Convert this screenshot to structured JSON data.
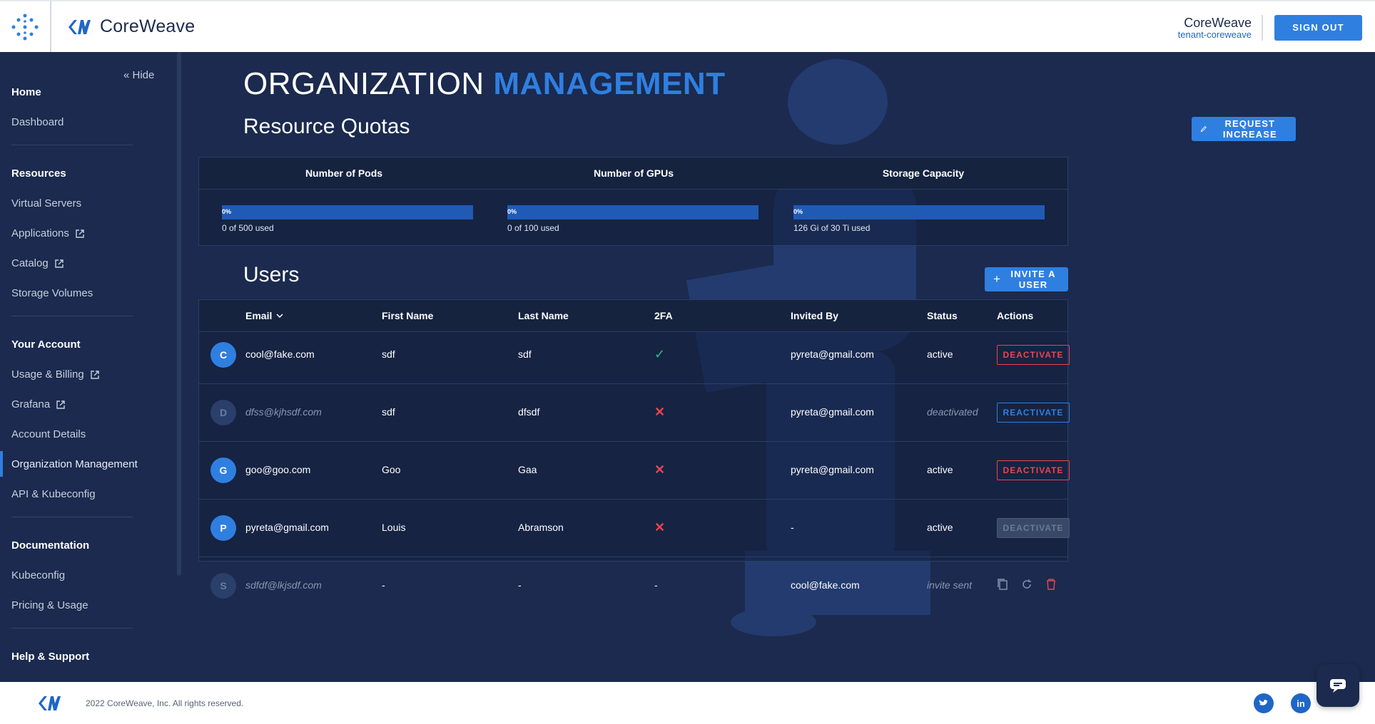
{
  "header": {
    "brand": "CoreWeave",
    "org_name": "CoreWeave",
    "tenant": "tenant-coreweave",
    "signout_label": "SIGN OUT"
  },
  "sidebar": {
    "hide_label": "Hide",
    "sections": [
      {
        "title": "Home",
        "items": [
          {
            "label": "Dashboard",
            "external": false
          }
        ]
      },
      {
        "title": "Resources",
        "items": [
          {
            "label": "Virtual Servers",
            "external": false
          },
          {
            "label": "Applications",
            "external": true
          },
          {
            "label": "Catalog",
            "external": true
          },
          {
            "label": "Storage Volumes",
            "external": false
          }
        ]
      },
      {
        "title": "Your Account",
        "items": [
          {
            "label": "Usage & Billing",
            "external": true
          },
          {
            "label": "Grafana",
            "external": true
          },
          {
            "label": "Account Details",
            "external": false
          },
          {
            "label": "Organization Management",
            "external": false,
            "active": true
          },
          {
            "label": "API & Kubeconfig",
            "external": false
          }
        ]
      },
      {
        "title": "Documentation",
        "items": [
          {
            "label": "Kubeconfig",
            "external": false
          },
          {
            "label": "Pricing & Usage",
            "external": false
          }
        ]
      },
      {
        "title": "Help & Support",
        "items": []
      }
    ]
  },
  "page": {
    "title_plain": "ORGANIZATION",
    "title_accent": "MANAGEMENT",
    "quotas_title": "Resource Quotas",
    "request_increase_label": "REQUEST INCREASE",
    "users_title": "Users",
    "invite_label": "INVITE A USER"
  },
  "quotas": [
    {
      "label": "Number of Pods",
      "percent": "0%",
      "fraction": 0,
      "used": "0 of 500 used"
    },
    {
      "label": "Number of GPUs",
      "percent": "0%",
      "fraction": 0,
      "used": "0 of 100 used"
    },
    {
      "label": "Storage Capacity",
      "percent": "0%",
      "fraction": 0,
      "used": "126 Gi of 30 Ti used"
    }
  ],
  "users_table": {
    "columns": [
      "Email",
      "First Name",
      "Last Name",
      "2FA",
      "Invited By",
      "Status",
      "Actions"
    ],
    "rows": [
      {
        "initial": "C",
        "email": "cool@fake.com",
        "first": "sdf",
        "last": "sdf",
        "twofa": "yes",
        "invited_by": "pyreta@gmail.com",
        "status": "active",
        "action": "DEACTIVATE",
        "dim": false
      },
      {
        "initial": "D",
        "email": "dfss@kjhsdf.com",
        "first": "sdf",
        "last": "dfsdf",
        "twofa": "no",
        "invited_by": "pyreta@gmail.com",
        "status": "deactivated",
        "action": "REACTIVATE",
        "dim": true
      },
      {
        "initial": "G",
        "email": "goo@goo.com",
        "first": "Goo",
        "last": "Gaa",
        "twofa": "no",
        "invited_by": "pyreta@gmail.com",
        "status": "active",
        "action": "DEACTIVATE",
        "dim": false
      },
      {
        "initial": "P",
        "email": "pyreta@gmail.com",
        "first": "Louis",
        "last": "Abramson",
        "twofa": "no",
        "invited_by": "-",
        "status": "active",
        "action": "DEACTIVATE",
        "action_disabled": true,
        "dim": false
      },
      {
        "initial": "S",
        "email": "sdfdf@lkjsdf.com",
        "first": "-",
        "last": "-",
        "twofa": "-",
        "invited_by": "cool@fake.com",
        "status": "invite sent",
        "action": "icons",
        "dim": true
      }
    ]
  },
  "footer": {
    "copyright": "2022 CoreWeave, Inc. All rights reserved.",
    "social": [
      "twitter-icon",
      "linkedin-icon"
    ]
  },
  "colors": {
    "background": "#1b2a4e",
    "accent": "#2f7fe0",
    "danger": "#e8454f",
    "success": "#2bbd7e"
  }
}
